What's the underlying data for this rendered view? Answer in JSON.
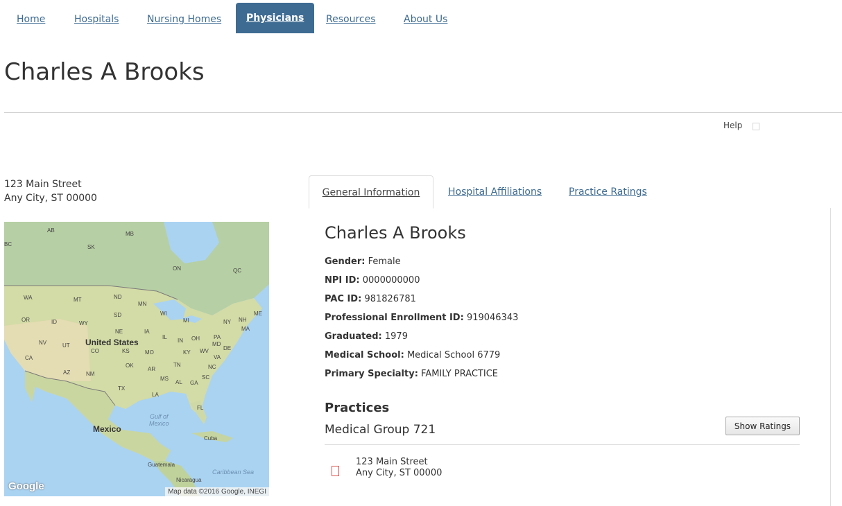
{
  "nav": {
    "items": [
      {
        "label": "Home",
        "active": false
      },
      {
        "label": "Hospitals",
        "active": false
      },
      {
        "label": "Nursing Homes",
        "active": false
      },
      {
        "label": "Physicians",
        "active": true
      },
      {
        "label": "Resources",
        "active": false
      },
      {
        "label": "About Us",
        "active": false
      }
    ]
  },
  "page_title": "Charles A Brooks",
  "help": {
    "label": "Help"
  },
  "address": {
    "line1": "123 Main Street",
    "line2": "Any City, ST 00000"
  },
  "map": {
    "logo": "Google",
    "credit": "Map data ©2016 Google, INEGI",
    "labels": {
      "ab": "AB",
      "mb": "MB",
      "bc": "BC",
      "sk": "SK",
      "on": "ON",
      "qc": "QC",
      "wa": "WA",
      "mt": "MT",
      "nd": "ND",
      "mn": "MN",
      "or": "OR",
      "id": "ID",
      "wy": "WY",
      "sd": "SD",
      "wi": "WI",
      "mi": "MI",
      "ny": "NY",
      "nh": "NH",
      "me": "ME",
      "ma": "MA",
      "ne": "NE",
      "ia": "IA",
      "il": "IL",
      "in": "IN",
      "oh": "OH",
      "pa": "PA",
      "md": "MD",
      "de": "DE",
      "nv": "NV",
      "ut": "UT",
      "co": "CO",
      "ks": "KS",
      "mo": "MO",
      "ky": "KY",
      "wv": "WV",
      "va": "VA",
      "ca": "CA",
      "ok": "OK",
      "ar": "AR",
      "tn": "TN",
      "nc": "NC",
      "az": "AZ",
      "nm": "NM",
      "ms": "MS",
      "al": "AL",
      "ga": "GA",
      "sc": "SC",
      "tx": "TX",
      "la": "LA",
      "fl": "FL",
      "us": "United States",
      "mexico": "Mexico",
      "gulf1": "Gulf of",
      "gulf2": "Mexico",
      "cuba": "Cuba",
      "guatemala": "Guatemala",
      "caribbean": "Caribbean Sea",
      "nicaragua": "Nicaragua"
    }
  },
  "tabs": [
    {
      "label": "General Information",
      "active": true
    },
    {
      "label": "Hospital Affiliations",
      "active": false
    },
    {
      "label": "Practice Ratings",
      "active": false
    }
  ],
  "info": {
    "name": "Charles A Brooks",
    "fields": [
      {
        "label": "Gender:",
        "value": "Female"
      },
      {
        "label": "NPI ID:",
        "value": "0000000000"
      },
      {
        "label": "PAC ID:",
        "value": "981826781"
      },
      {
        "label": "Professional Enrollment ID:",
        "value": "919046343"
      },
      {
        "label": "Graduated:",
        "value": "1979"
      },
      {
        "label": "Medical School:",
        "value": "Medical School 6779"
      },
      {
        "label": "Primary Specialty:",
        "value": "FAMILY PRACTICE"
      }
    ]
  },
  "practices": {
    "heading": "Practices",
    "group_name": "Medical Group 721",
    "button_label": "Show Ratings",
    "address": {
      "line1": "123 Main Street",
      "line2": "Any City, ST 00000"
    }
  },
  "colors": {
    "accent": "#3e6b92",
    "pin": "#d9534f"
  }
}
